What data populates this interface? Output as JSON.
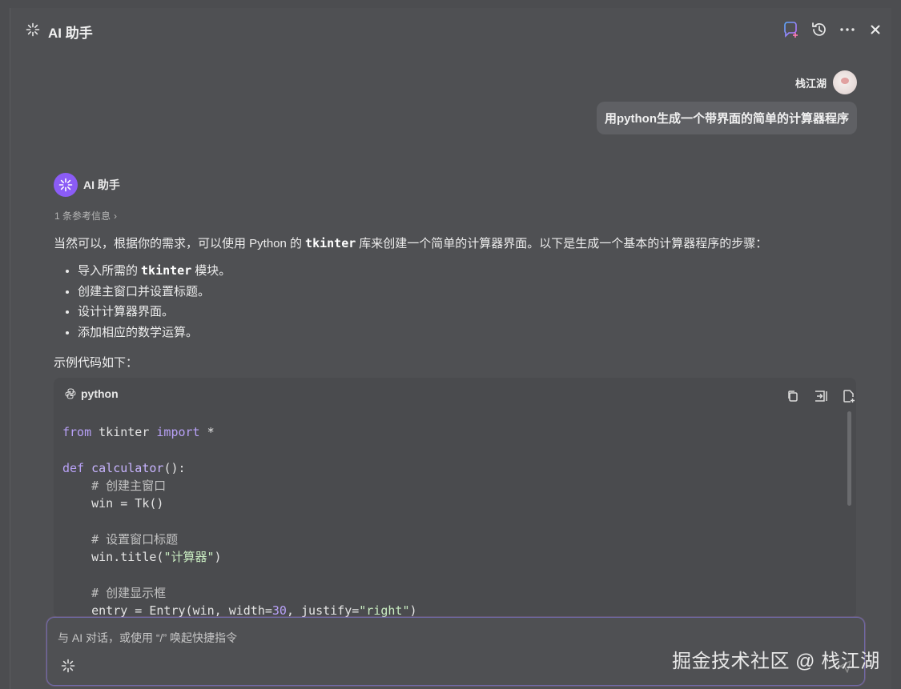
{
  "header": {
    "title": "AI 助手",
    "icons": [
      "new-chat-icon",
      "history-icon",
      "more-icon",
      "close-icon"
    ]
  },
  "user_message": {
    "name": "栈江湖",
    "text": "用python生成一个带界面的简单的计算器程序"
  },
  "assistant": {
    "name": "AI 助手",
    "refs": "1 条参考信息",
    "intro_before": "当然可以，根据你的需求，可以使用 Python 的",
    "intro_code": "tkinter",
    "intro_after": "库来创建一个简单的计算器界面。以下是生成一个基本的计算器程序的步骤：",
    "steps": [
      {
        "before": "导入所需的",
        "code": "tkinter",
        "after": "模块。"
      },
      {
        "text": "创建主窗口并设置标题。"
      },
      {
        "text": "设计计算器界面。"
      },
      {
        "text": "添加相应的数学运算。"
      }
    ],
    "example_label": "示例代码如下：",
    "code_block": {
      "language": "python",
      "actions": [
        "copy-icon",
        "insert-icon",
        "new-file-icon"
      ],
      "lines": {
        "l1_kw1": "from",
        "l1_mid": " tkinter ",
        "l1_kw2": "import",
        "l1_end": " *",
        "l3_kw": "def",
        "l3_fn": "calculator",
        "l3_end": "():",
        "l4": "# 创建主窗口",
        "l5": "win = Tk()",
        "l7": "# 设置窗口标题",
        "l8_pre": "win.title(",
        "l8_str": "\"计算器\"",
        "l8_end": ")",
        "l10": "# 创建显示框",
        "l11_pre": "entry = Entry(win, width=",
        "l11_num": "30",
        "l11_mid": ", justify=",
        "l11_str": "\"right\"",
        "l11_end": ")"
      }
    }
  },
  "input": {
    "placeholder": "与 AI 对话，或使用 “/” 唤起快捷指令"
  },
  "watermark": "掘金技术社区 @ 栈江湖"
}
